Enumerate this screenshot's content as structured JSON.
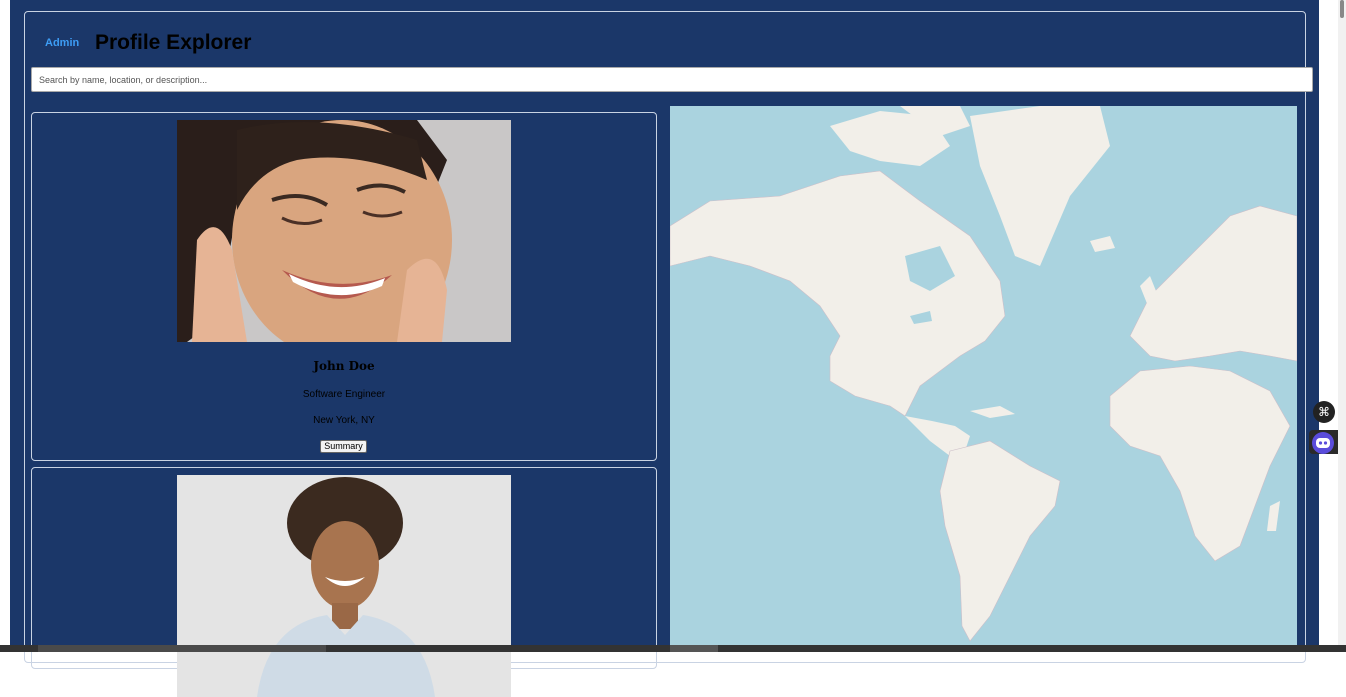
{
  "header": {
    "admin_link": "Admin",
    "title": "Profile Explorer"
  },
  "search": {
    "placeholder": "Search by name, location, or description...",
    "value": ""
  },
  "profiles": [
    {
      "name": "John Doe",
      "role": "Software Engineer",
      "location": "New York, NY",
      "button_label": "Summary"
    },
    {
      "name": "",
      "role": "",
      "location": "",
      "button_label": ""
    }
  ],
  "colors": {
    "page_bg": "#1b3769",
    "link": "#3d9df5",
    "map_water": "#aad3df",
    "map_land": "#f2efe9"
  }
}
